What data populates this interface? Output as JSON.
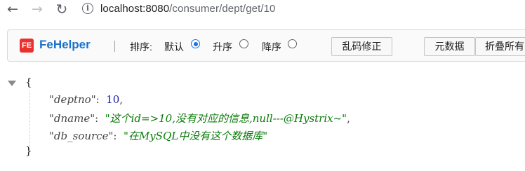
{
  "browser": {
    "back_icon": "arrow-left-icon",
    "forward_icon": "arrow-right-icon",
    "reload_icon": "reload-icon",
    "info_icon": "info-icon",
    "url_host": "localhost:8080",
    "url_path": "/consumer/dept/get/10"
  },
  "fehelper": {
    "logo_text": "FE",
    "title": "FeHelper",
    "sort_label": "排序:",
    "sort_options": [
      {
        "label": "默认",
        "checked": true
      },
      {
        "label": "升序",
        "checked": false
      },
      {
        "label": "降序",
        "checked": false
      }
    ],
    "fix_encoding_button": "乱码修正",
    "metadata_button": "元数据",
    "collapse_all_button": "折叠所有"
  },
  "json": {
    "open_brace": "{",
    "close_brace": "}",
    "entries": [
      {
        "key": "\"deptno\"",
        "value": "10",
        "type": "number",
        "trailing_comma": true
      },
      {
        "key": "\"dname\"",
        "value": "\"这个id=>10,没有对应的信息,null---@Hystrix~\"",
        "type": "string",
        "trailing_comma": true
      },
      {
        "key": "\"db_source\"",
        "value": "\"在MySQL中没有这个数据库\"",
        "type": "string",
        "trailing_comma": false
      }
    ]
  },
  "colors": {
    "number": "#1a1aa6",
    "string": "#0b7a0b",
    "fehelper_title": "#1a73c8",
    "logo_bg": "#e8322f"
  }
}
